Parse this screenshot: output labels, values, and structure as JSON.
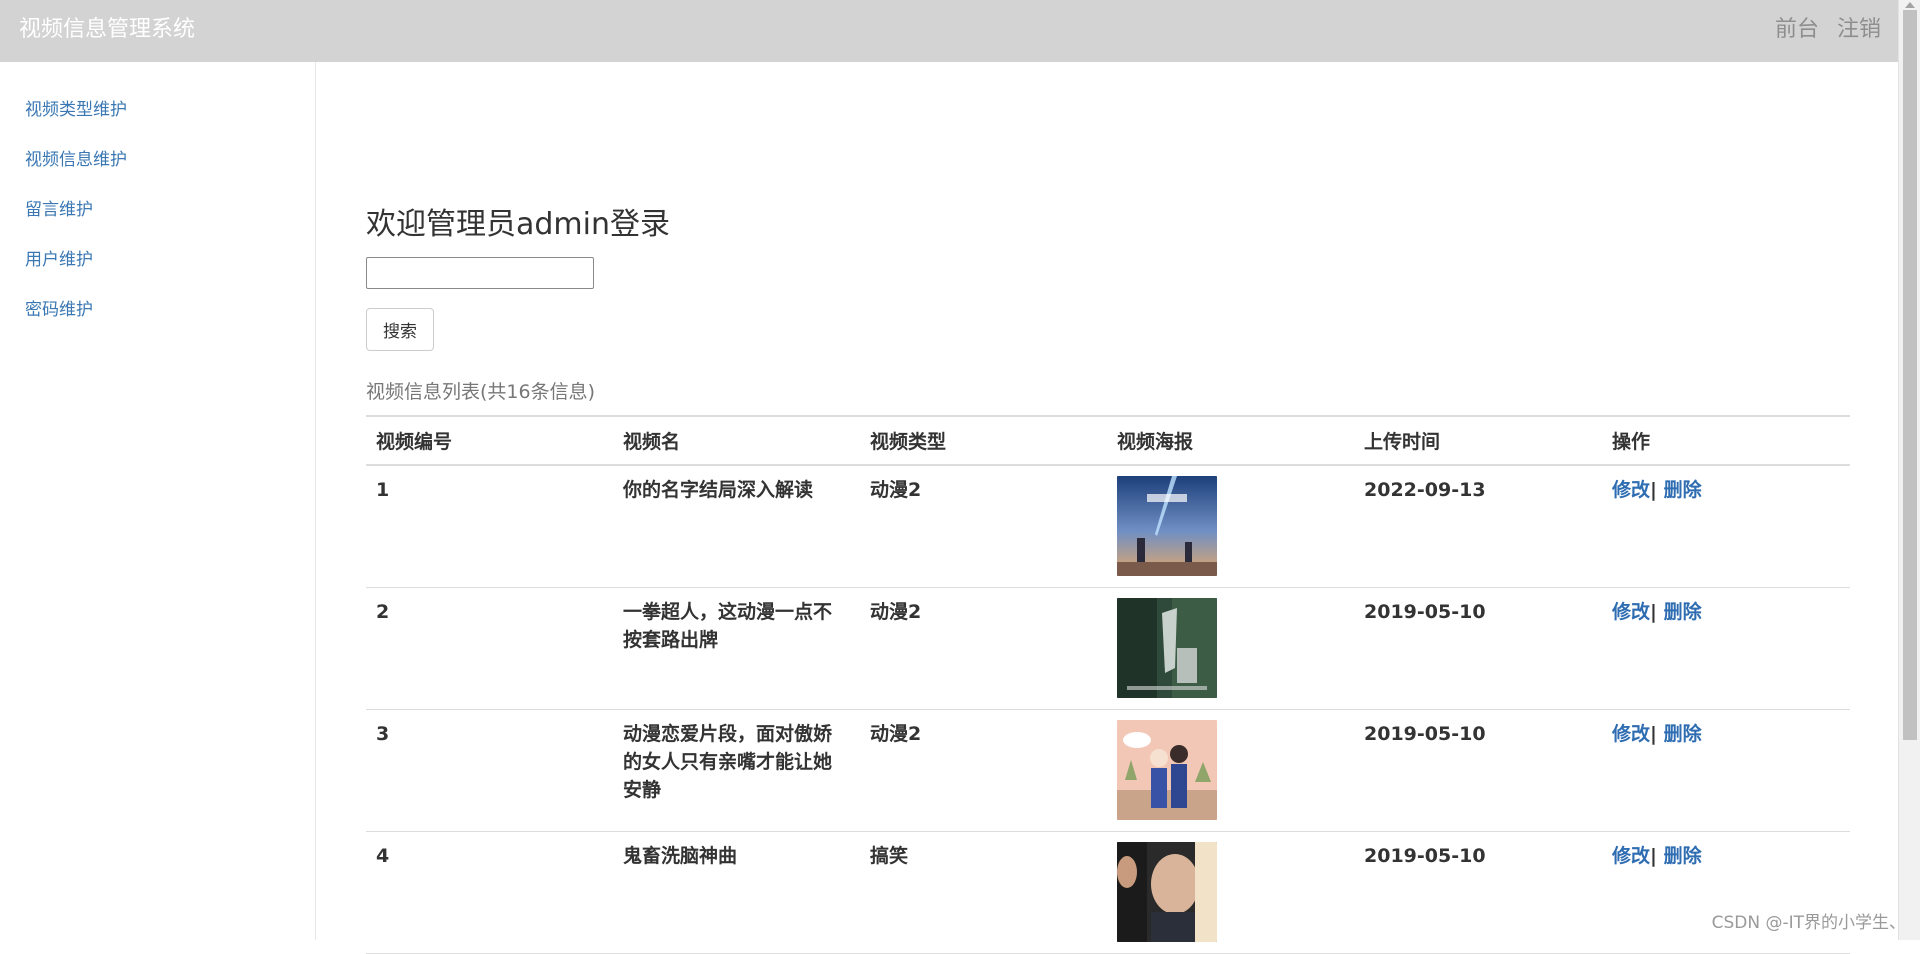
{
  "app": {
    "title": "视频信息管理系统"
  },
  "navbar": {
    "links": [
      "前台",
      "注销"
    ]
  },
  "sidebar": {
    "items": [
      {
        "label": "视频类型维护"
      },
      {
        "label": "视频信息维护"
      },
      {
        "label": "留言维护"
      },
      {
        "label": "用户维护"
      },
      {
        "label": "密码维护"
      }
    ]
  },
  "main": {
    "welcome": "欢迎管理员admin登录",
    "search": {
      "value": "",
      "button_label": "搜索"
    },
    "caption": "视频信息列表(共16条信息)",
    "table": {
      "headers": [
        "视频编号",
        "视频名",
        "视频类型",
        "视频海报",
        "上传时间",
        "操作"
      ],
      "rows": [
        {
          "id": "1",
          "name": "你的名字结局深入解读",
          "type": "动漫2",
          "poster_icon": "poster-your-name",
          "date": "2022-09-13",
          "edit": "修改",
          "sep": "|",
          "delete": "删除"
        },
        {
          "id": "2",
          "name": "一拳超人，这动漫一点不按套路出牌",
          "type": "动漫2",
          "poster_icon": "poster-one-punch",
          "date": "2019-05-10",
          "edit": "修改",
          "sep": "|",
          "delete": "删除"
        },
        {
          "id": "3",
          "name": "动漫恋爱片段，面对傲娇的女人只有亲嘴才能让她安静",
          "type": "动漫2",
          "poster_icon": "poster-anime-love",
          "date": "2019-05-10",
          "edit": "修改",
          "sep": "|",
          "delete": "删除"
        },
        {
          "id": "4",
          "name": "鬼畜洗脑神曲",
          "type": "搞笑",
          "poster_icon": "poster-meme",
          "date": "2019-05-10",
          "edit": "修改",
          "sep": "|",
          "delete": "删除"
        }
      ]
    }
  },
  "watermark": "CSDN @-IT界的小学生、",
  "colors": {
    "navbar_bg": "#d3d3d3",
    "link": "#3a77b3",
    "op_link": "#2f6db2"
  }
}
